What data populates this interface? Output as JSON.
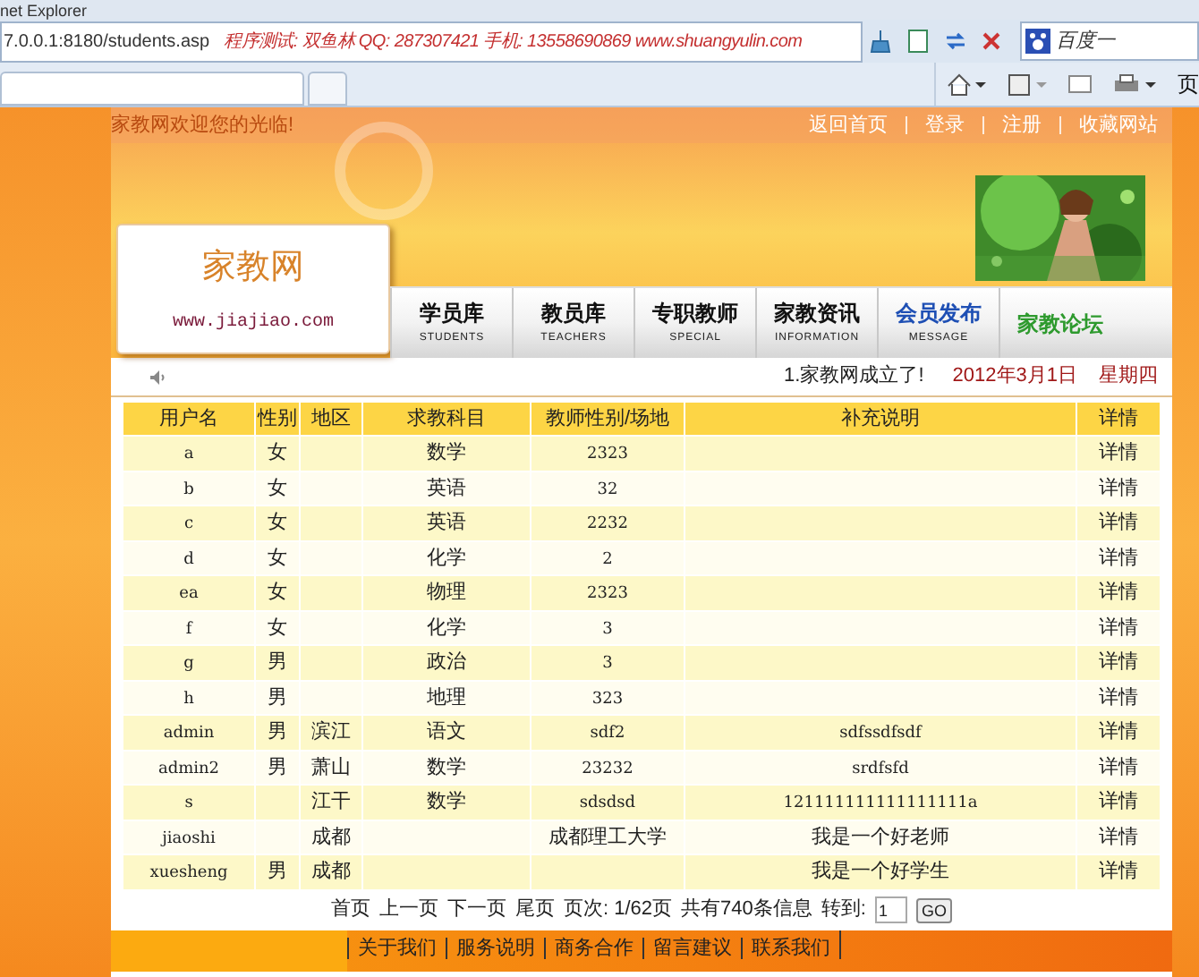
{
  "browser": {
    "title": "net Explorer",
    "address": "7.0.0.1:8180/students.asp",
    "address_note": "程序测试: 双鱼林  QQ: 287307421  手机: 13558690869  www.shuangyulin.com",
    "search_engine": "百度一",
    "page_menu": "页"
  },
  "header": {
    "welcome": "家教网欢迎您的光临!",
    "top_links": [
      "返回首页",
      "登录",
      "注册",
      "收藏网站"
    ],
    "logo_title": "家教网",
    "logo_url": "www.jiajiao.com"
  },
  "nav": [
    {
      "label": "学员库",
      "sub": "STUDENTS",
      "color": "#111111"
    },
    {
      "label": "教员库",
      "sub": "TEACHERS",
      "color": "#111111"
    },
    {
      "label": "专职教师",
      "sub": "SPECIAL",
      "color": "#111111"
    },
    {
      "label": "家教资讯",
      "sub": "INFORMATION",
      "color": "#111111"
    },
    {
      "label": "会员发布",
      "sub": "MESSAGE",
      "color": "#1e4fb4"
    },
    {
      "label": "家教论坛",
      "color": "#2e9a2e"
    }
  ],
  "ticker": {
    "news": "1.家教网成立了!",
    "date": "2012年3月1日",
    "weekday": "星期四"
  },
  "table": {
    "columns": [
      "用户名",
      "性别",
      "地区",
      "求教科目",
      "教师性别/场地",
      "补充说明",
      "详情"
    ],
    "rows": [
      [
        "a",
        "女",
        "",
        "数学",
        "2323",
        "",
        "详情"
      ],
      [
        "b",
        "女",
        "",
        "英语",
        "32",
        "",
        "详情"
      ],
      [
        "c",
        "女",
        "",
        "英语",
        "2232",
        "",
        "详情"
      ],
      [
        "d",
        "女",
        "",
        "化学",
        "2",
        "",
        "详情"
      ],
      [
        "ea",
        "女",
        "",
        "物理",
        "2323",
        "",
        "详情"
      ],
      [
        "f",
        "女",
        "",
        "化学",
        "3",
        "",
        "详情"
      ],
      [
        "g",
        "男",
        "",
        "政治",
        "3",
        "",
        "详情"
      ],
      [
        "h",
        "男",
        "",
        "地理",
        "323",
        "",
        "详情"
      ],
      [
        "admin",
        "男",
        "滨江",
        "语文",
        "sdf2",
        "sdfssdfsdf",
        "详情"
      ],
      [
        "admin2",
        "男",
        "萧山",
        "数学",
        "23232",
        "srdfsfd",
        "详情"
      ],
      [
        "s",
        "",
        "江干",
        "数学",
        "sdsdsd",
        "121111111111111111a",
        "详情"
      ],
      [
        "jiaoshi",
        "",
        "成都",
        "",
        "成都理工大学",
        "我是一个好老师",
        "详情"
      ],
      [
        "xuesheng",
        "男",
        "成都",
        "",
        "",
        "我是一个好学生",
        "详情"
      ]
    ]
  },
  "pagination": {
    "links": [
      "首页",
      "上一页",
      "下一页",
      "尾页"
    ],
    "page": "页次: 1/62页",
    "total": "共有740条信息",
    "goto_label": "转到:",
    "goto_value": "1",
    "go_button": "GO"
  },
  "footer": {
    "links": [
      "关于我们",
      "服务说明",
      "商务合作",
      "留言建议",
      "联系我们"
    ]
  }
}
